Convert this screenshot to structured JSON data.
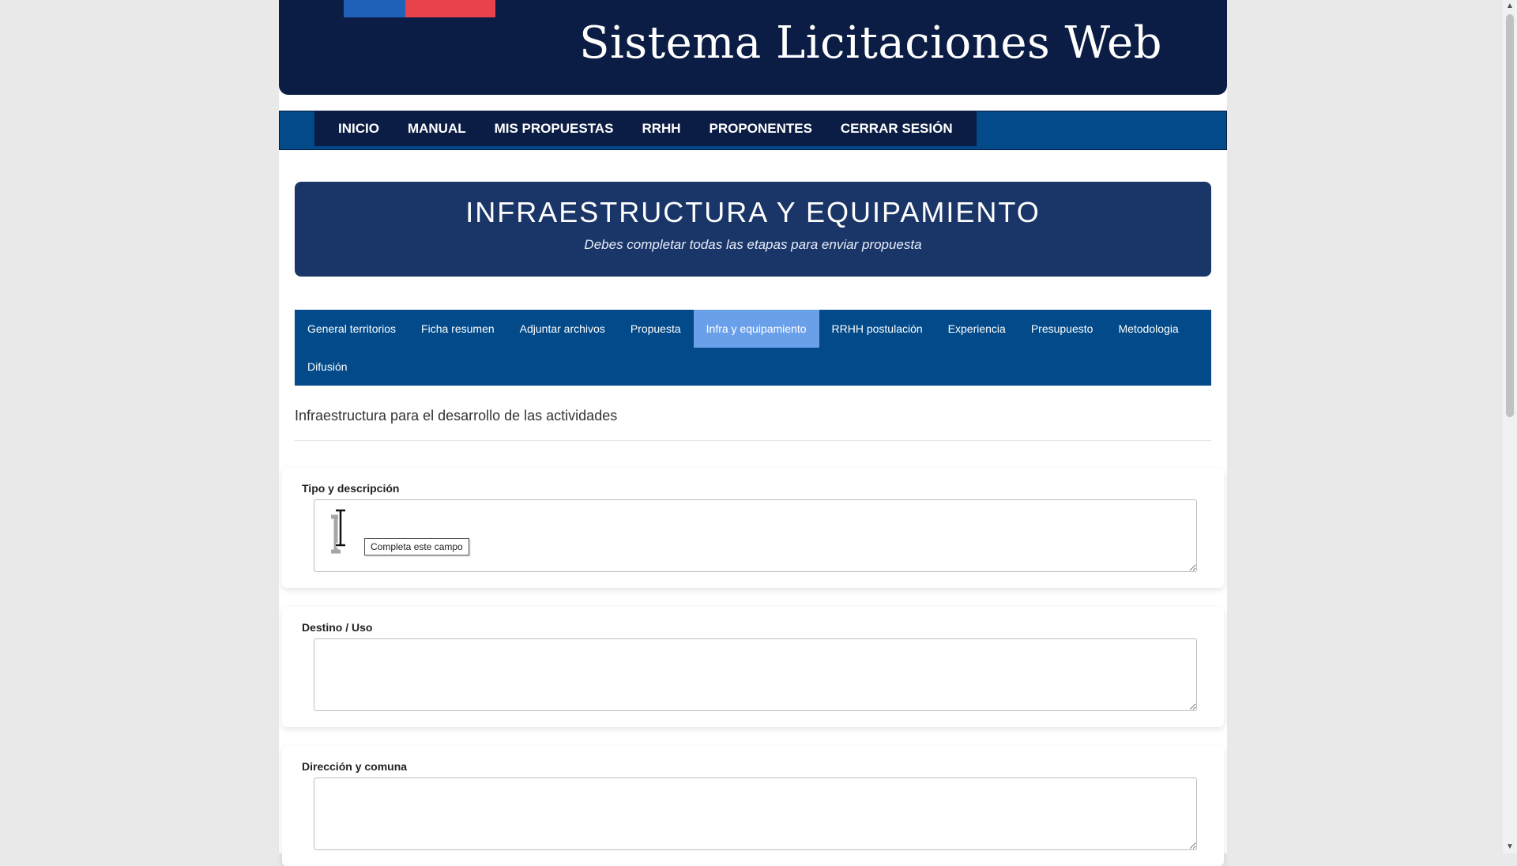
{
  "header": {
    "title": "Sistema Licitaciones Web"
  },
  "nav": {
    "items": [
      "INICIO",
      "MANUAL",
      "MIS PROPUESTAS",
      "RRHH",
      "PROPONENTES",
      "CERRAR SESIÓN"
    ]
  },
  "banner": {
    "title": "INFRAESTRUCTURA Y EQUIPAMIENTO",
    "subtitle": "Debes completar todas las etapas para enviar propuesta"
  },
  "tabs": {
    "items": [
      "General territorios",
      "Ficha resumen",
      "Adjuntar archivos",
      "Propuesta",
      "Infra y equipamiento",
      "RRHH postulación",
      "Experiencia",
      "Presupuesto",
      "Metodologia",
      "Difusión"
    ],
    "active": "Infra y equipamiento"
  },
  "section": {
    "title": "Infraestructura para el desarrollo de las actividades"
  },
  "fields": [
    {
      "label": "Tipo y descripción",
      "value": ""
    },
    {
      "label": "Destino / Uso",
      "value": ""
    },
    {
      "label": "Dirección y comuna",
      "value": ""
    }
  ],
  "tooltip": {
    "text": "Completa este campo"
  },
  "icons": {
    "cursor": "text-cursor-icon",
    "scroll_up": "scroll-up-arrow-icon",
    "scroll_down": "scroll-down-arrow-icon"
  },
  "colors": {
    "header_bg": "#0b1d44",
    "nav_bg": "#024a8a",
    "banner_bg": "#1a3668",
    "tab_active": "#6aa0ea",
    "flag_blue": "#1f60b8",
    "flag_red": "#e8424a"
  }
}
